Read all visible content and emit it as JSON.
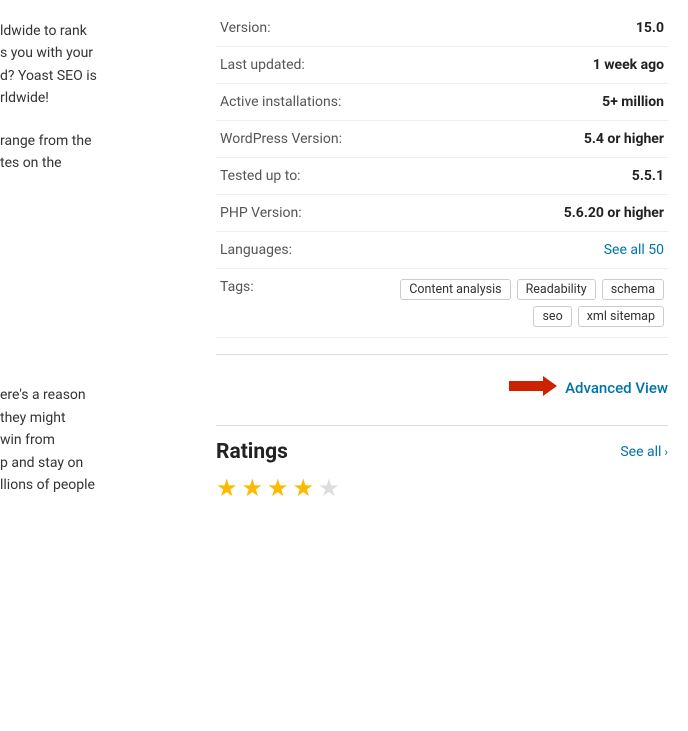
{
  "left_column": {
    "fragment1": {
      "lines": [
        "ldwide to rank",
        "s you with your",
        "d? Yoast SEO is",
        "rldwide!"
      ]
    },
    "fragment2": {
      "lines": [
        "range from the",
        "tes on the"
      ]
    },
    "fragment3": {
      "lines": [
        "ere's a reason",
        "they might",
        "win from",
        "p and stay on",
        "llions of people"
      ]
    }
  },
  "info": {
    "version_label": "Version:",
    "version_value": "15.0",
    "last_updated_label": "Last updated:",
    "last_updated_value": "1 week ago",
    "active_installs_label": "Active installations:",
    "active_installs_value": "5+ million",
    "wp_version_label": "WordPress Version:",
    "wp_version_value": "5.4 or higher",
    "tested_label": "Tested up to:",
    "tested_value": "5.5.1",
    "php_label": "PHP Version:",
    "php_value": "5.6.20 or higher",
    "languages_label": "Languages:",
    "languages_value": "See all 50",
    "tags_label": "Tags:",
    "tags": [
      "Content analysis",
      "Readability",
      "schema",
      "seo",
      "xml sitemap"
    ]
  },
  "advanced_view": {
    "label": "Advanced View"
  },
  "ratings": {
    "title": "Ratings",
    "see_all_label": "See all",
    "stars": [
      1,
      1,
      1,
      1,
      0
    ],
    "star_count": 4
  }
}
